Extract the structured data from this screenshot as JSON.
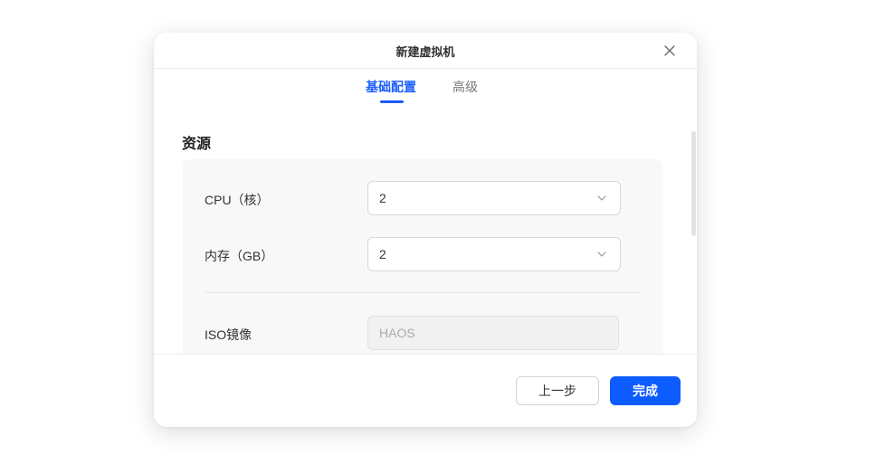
{
  "dialog": {
    "title": "新建虚拟机"
  },
  "tabs": [
    {
      "label": "基础配置",
      "active": true
    },
    {
      "label": "高级",
      "active": false
    }
  ],
  "resources": {
    "title": "资源",
    "cpu": {
      "label": "CPU（核）",
      "value": "2"
    },
    "memory": {
      "label": "内存（GB）",
      "value": "2"
    },
    "iso": {
      "label": "ISO镜像",
      "placeholder": "HAOS"
    }
  },
  "footer": {
    "prev_label": "上一步",
    "finish_label": "完成"
  },
  "icons": {
    "close": "close-icon",
    "chevron": "chevron-down-icon"
  },
  "colors": {
    "accent": "#1a5cff",
    "primary_button": "#0d5cff"
  }
}
